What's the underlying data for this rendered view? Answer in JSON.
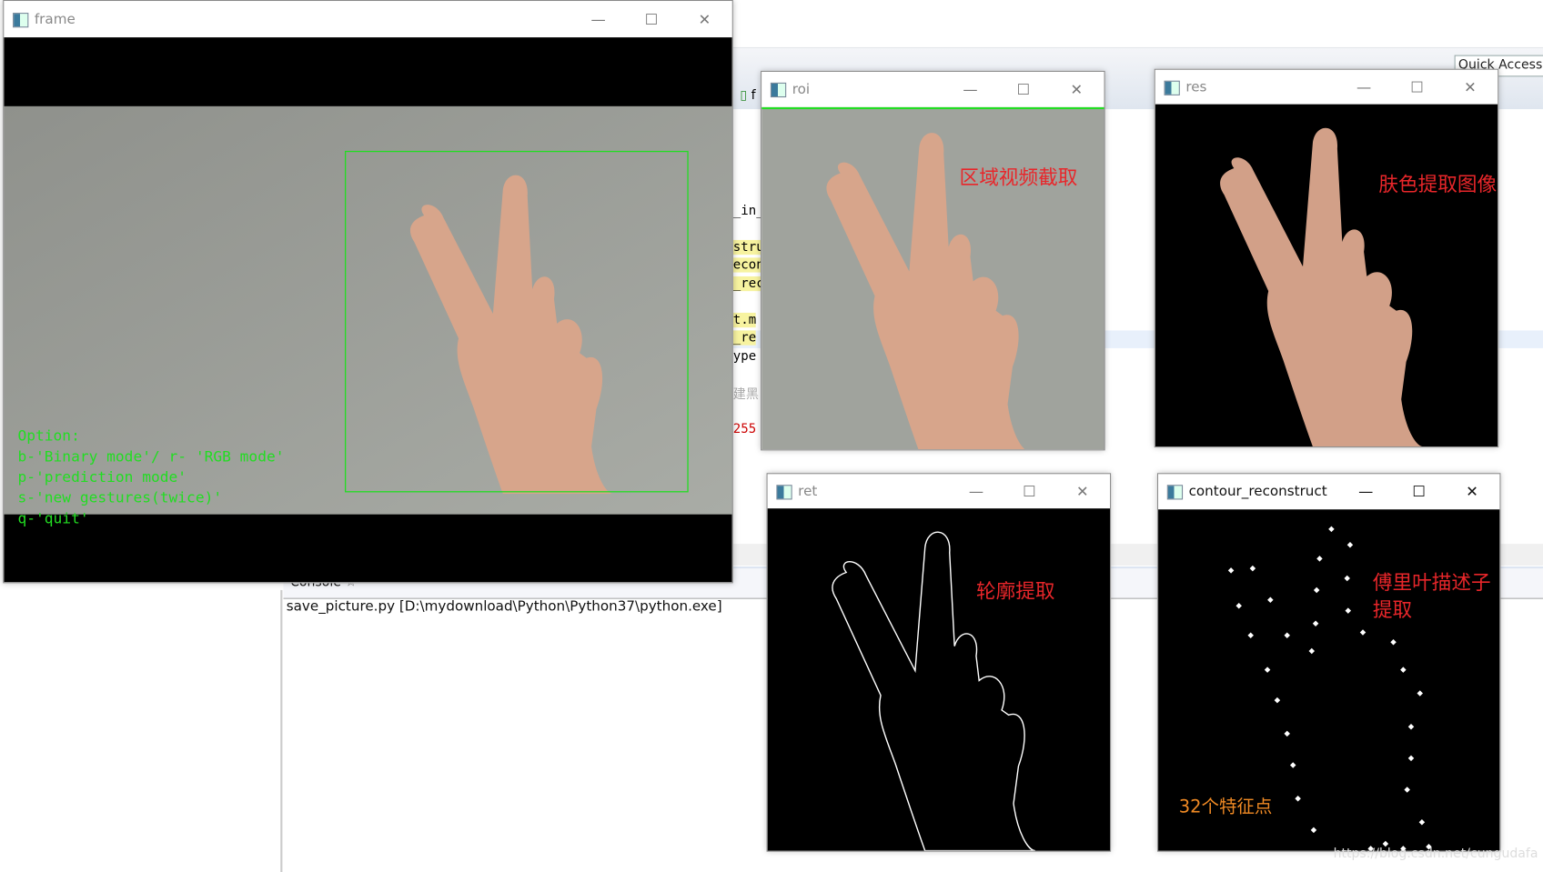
{
  "ide": {
    "quick_access": "Quick Access",
    "editor_tab_fragment": "f",
    "code_fragments": [
      "_in_",
      "stru",
      "econs",
      "_reco",
      "t.m",
      "_re",
      "ype",
      "建黑",
      "255"
    ],
    "console_tab": "Console",
    "console_tab_icon": "star-icon",
    "console_line": "save_picture.py [D:\\mydownload\\Python\\Python37\\python.exe]"
  },
  "windows": {
    "frame": {
      "title": "frame",
      "options": [
        "Option:",
        "b-'Binary mode'/ r- 'RGB mode'",
        "p-'prediction mode'",
        "s-'new gestures(twice)'",
        "q-'quit'"
      ]
    },
    "roi": {
      "title": "roi",
      "annotation": "区域视频截取"
    },
    "res": {
      "title": "res",
      "annotation": "肤色提取图像"
    },
    "ret": {
      "title": "ret",
      "annotation": "轮廓提取"
    },
    "contour": {
      "title": "contour_reconstruct",
      "annotation_line1": "傅里叶描述子",
      "annotation_line2": "提取",
      "feature_label": "32个特征点"
    }
  },
  "controls": {
    "minimize": "—",
    "maximize": "☐",
    "close": "✕"
  },
  "watermark": "https://blog.csdn.net/cungudafa",
  "colors": {
    "overlay_green": "#22dd22",
    "annotation_red": "#e8262a",
    "feature_orange": "#f08a24",
    "skin": "#d9a88e"
  }
}
